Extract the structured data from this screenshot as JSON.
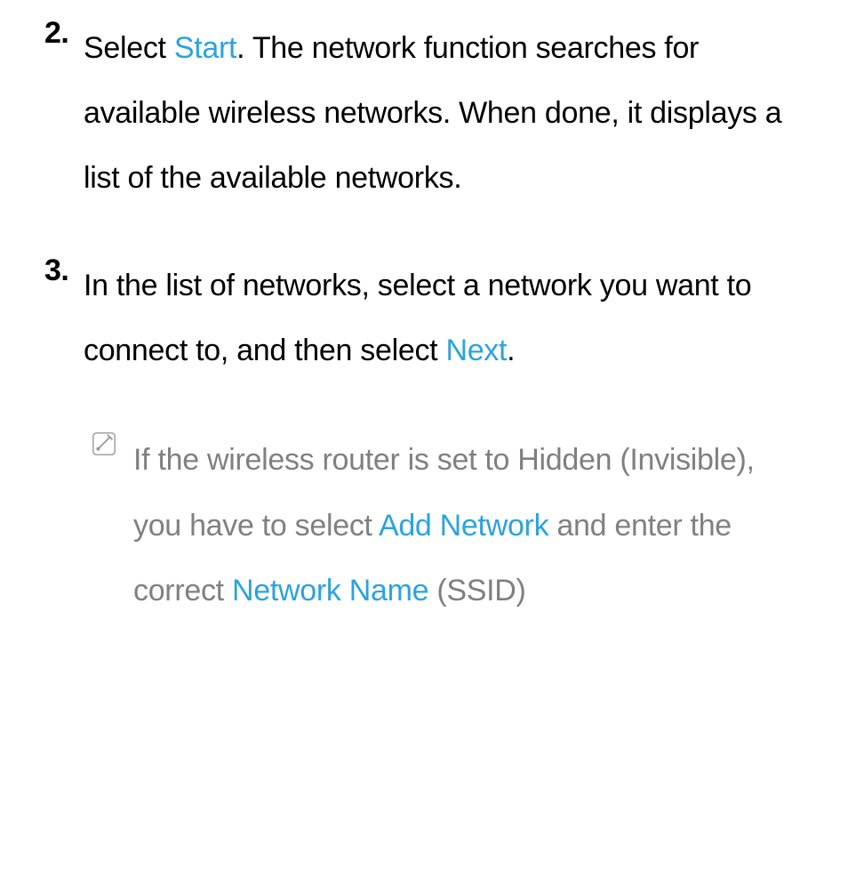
{
  "steps": [
    {
      "number": "2.",
      "parts": [
        {
          "text": "Select ",
          "highlight": false
        },
        {
          "text": "Start",
          "highlight": true
        },
        {
          "text": ". The network function searches for available wireless networks. When done, it displays a list of the available networks.",
          "highlight": false
        }
      ]
    },
    {
      "number": "3.",
      "parts": [
        {
          "text": "In the list of networks, select a network you want to connect to, and then select ",
          "highlight": false
        },
        {
          "text": "Next",
          "highlight": true
        },
        {
          "text": ".",
          "highlight": false
        }
      ]
    }
  ],
  "note": {
    "parts": [
      {
        "text": "If the wireless router is set to Hidden (Invisible), you have to select ",
        "highlight": false
      },
      {
        "text": "Add Network",
        "highlight": true
      },
      {
        "text": " and enter the correct ",
        "highlight": false
      },
      {
        "text": "Network Name",
        "highlight": true
      },
      {
        "text": " (SSID)",
        "highlight": false
      }
    ]
  }
}
